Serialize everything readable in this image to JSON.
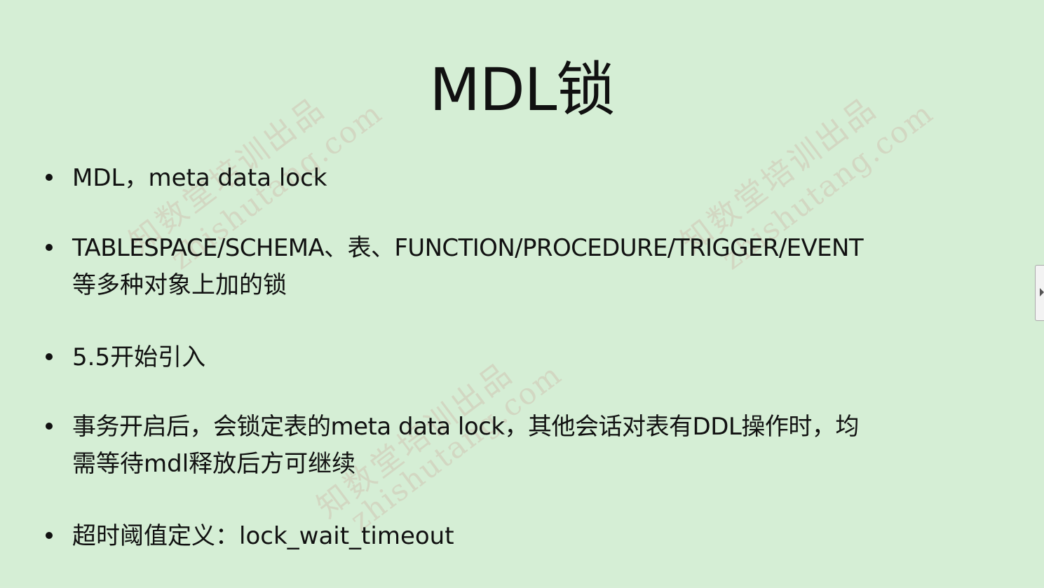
{
  "slide": {
    "title": "MDL锁",
    "bullets": [
      {
        "lines": [
          "MDL，meta data lock"
        ]
      },
      {
        "lines": [
          "TABLESPACE/SCHEMA、表、FUNCTION/PROCEDURE/TRIGGER/EVENT",
          "等多种对象上加的锁"
        ]
      },
      {
        "lines": [
          "5.5开始引入"
        ]
      },
      {
        "lines": [
          "事务开启后，会锁定表的meta data lock，其他会话对表有DDL操作时，均",
          "需等待mdl释放后方可继续"
        ]
      },
      {
        "lines": [
          "超时阈值定义：lock_wait_timeout"
        ]
      }
    ]
  },
  "watermarks": [
    {
      "main": "知数堂培训出品",
      "sub": "zhishutang.com"
    },
    {
      "main": "知数堂培训出品",
      "sub": "zhishutang.com"
    },
    {
      "main": "知数堂培训出品",
      "sub": "zhishutang.com"
    }
  ],
  "colors": {
    "background": "#d5eed5",
    "text": "#111111",
    "watermark": "#c86e6e"
  },
  "icons": {
    "side_tab": "triangle-right-icon"
  }
}
